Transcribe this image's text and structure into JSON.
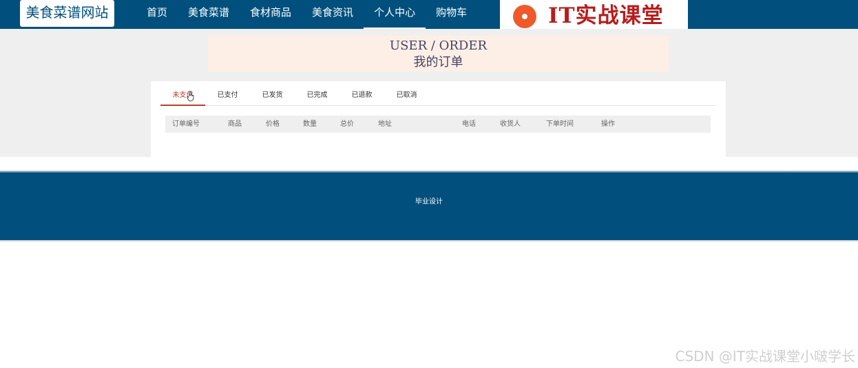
{
  "header": {
    "logo": "美食菜谱网站",
    "nav": [
      "首页",
      "美食菜谱",
      "食材商品",
      "美食资讯",
      "个人中心",
      "购物车"
    ],
    "active_nav": "个人中心",
    "banner_text": "IT实战课堂"
  },
  "page_title": {
    "en": "USER / ORDER",
    "cn": "我的订单"
  },
  "tabs": [
    "未支付",
    "已支付",
    "已发货",
    "已完成",
    "已退款",
    "已取消"
  ],
  "active_tab": "未支付",
  "table": {
    "columns": [
      "订单编号",
      "商品",
      "价格",
      "数量",
      "总价",
      "地址",
      "电话",
      "收货人",
      "下单时间",
      "操作"
    ]
  },
  "footer": {
    "text": "毕业设计"
  },
  "watermark": "CSDN @IT实战课堂小啵学长",
  "colors": {
    "primary": "#004f7d",
    "accent": "#c0392b",
    "title_bg": "#fdefe6"
  }
}
